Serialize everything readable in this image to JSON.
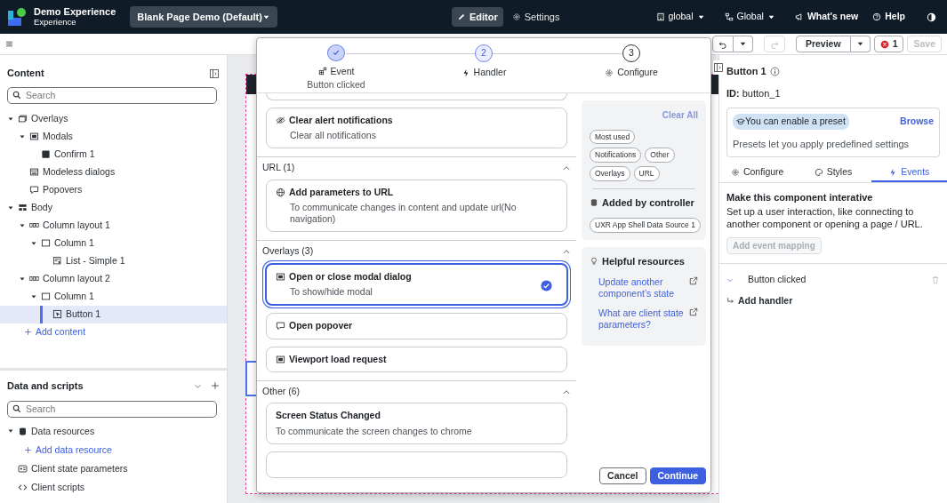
{
  "app": {
    "title": "Demo Experience",
    "subtitle": "Experience",
    "page": "Blank Page Demo (Default)"
  },
  "modes": [
    {
      "label": "Editor",
      "selected": true
    },
    {
      "label": "Settings",
      "selected": false
    }
  ],
  "header_links": [
    {
      "label": "global",
      "kind": "dropdown"
    },
    {
      "label": "Global",
      "kind": "dropdown"
    },
    {
      "label": "What's new",
      "kind": "link"
    },
    {
      "label": "Help",
      "kind": "link"
    }
  ],
  "toolbar": {
    "preview": "Preview",
    "error_count": "1",
    "save": {
      "label": "Save",
      "disabled": true
    }
  },
  "content": {
    "title": "Content",
    "search_placeholder": "Search",
    "tree": [
      {
        "label": "Overlays",
        "kind": "overlays",
        "expanded": true,
        "selected": false,
        "children": [
          {
            "label": "Modals",
            "kind": "modal",
            "expanded": true,
            "selected": false,
            "children": [
              {
                "label": "Confirm 1",
                "kind": "square",
                "selected": false
              }
            ]
          },
          {
            "label": "Modeless dialogs",
            "kind": "modeless",
            "selected": false
          },
          {
            "label": "Popovers",
            "kind": "popover",
            "selected": false
          }
        ]
      },
      {
        "label": "Body",
        "kind": "body",
        "expanded": true,
        "selected": false,
        "children": [
          {
            "label": "Column layout 1",
            "kind": "columns",
            "expanded": true,
            "selected": false,
            "children": [
              {
                "label": "Column 1",
                "kind": "column",
                "expanded": true,
                "selected": false,
                "children": [
                  {
                    "label": "List - Simple 1",
                    "kind": "list",
                    "selected": false
                  }
                ]
              }
            ]
          },
          {
            "label": "Column layout 2",
            "kind": "columns",
            "expanded": true,
            "selected": false,
            "children": [
              {
                "label": "Column 1",
                "kind": "column",
                "expanded": true,
                "selected": false,
                "children": [
                  {
                    "label": "Button 1",
                    "kind": "button",
                    "selected": true
                  }
                ]
              }
            ]
          }
        ]
      }
    ],
    "add_label": "Add content"
  },
  "data_scripts": {
    "title": "Data and scripts",
    "search_placeholder": "Search",
    "tree": [
      {
        "label": "Data resources",
        "kind": "database",
        "expanded": true,
        "selected": false,
        "add_label": "Add data resource"
      },
      {
        "label": "Client state parameters",
        "kind": "params",
        "selected": false
      },
      {
        "label": "Client scripts",
        "kind": "code",
        "selected": false
      }
    ]
  },
  "dialog": {
    "steps": [
      {
        "label": "Event",
        "sublabel": "Button clicked",
        "completed": true,
        "selected": false
      },
      {
        "number": "2",
        "label": "Handler",
        "completed": false,
        "selected": true
      },
      {
        "number": "3",
        "label": "Configure",
        "completed": false,
        "selected": false
      }
    ],
    "top_items": [
      {
        "title": "Clear alert notifications",
        "description": "Clear all notifications",
        "kind": "eye-off",
        "selected": false
      }
    ],
    "groups": [
      {
        "title": "URL (1)",
        "expanded": true,
        "items": [
          {
            "title": "Add parameters to URL",
            "description": "To communicate changes in content and update url(No navigation)",
            "kind": "globe",
            "selected": false
          }
        ]
      },
      {
        "title": "Overlays (3)",
        "expanded": true,
        "items": [
          {
            "title": "Open or close modal dialog",
            "description": "To show/hide modal",
            "kind": "modal",
            "selected": true
          },
          {
            "title": "Open popover",
            "kind": "popover",
            "selected": false
          },
          {
            "title": "Viewport load request",
            "kind": "modal",
            "selected": false
          }
        ]
      },
      {
        "title": "Other (6)",
        "expanded": true,
        "items": [
          {
            "title": "Screen Status Changed",
            "description": "To communicate the screen changes to chrome",
            "selected": false
          }
        ]
      }
    ],
    "clear_all": {
      "label": "Clear All",
      "disabled": true
    },
    "filter_rows": [
      [
        "Most used"
      ],
      [
        "Notifications",
        "Other"
      ],
      [
        "Overlays",
        "URL"
      ]
    ],
    "controller": {
      "title": "Added by controller",
      "chips": [
        "UXR App Shell Data Source 1"
      ]
    },
    "resources": {
      "title": "Helpful resources",
      "links": [
        "Update another component’s state",
        "What are client state parameters?"
      ]
    },
    "buttons": {
      "cancel": "Cancel",
      "continue": "Continue"
    }
  },
  "inspector": {
    "title": "Button 1",
    "id_label": "ID:",
    "id_value": "button_1",
    "preset": {
      "title": "You can enable a preset",
      "action": "Browse",
      "description": "Presets let you apply predefined settings"
    },
    "tabs": [
      {
        "label": "Configure",
        "selected": false
      },
      {
        "label": "Styles",
        "selected": false
      },
      {
        "label": "Events",
        "selected": true
      }
    ],
    "heading": "Make this component interative",
    "description": "Set up a user interaction, like connecting to another component or opening a page / URL.",
    "add_mapping": {
      "label": "Add event mapping",
      "disabled": true
    },
    "events": [
      {
        "label": "Button clicked",
        "expanded": true,
        "add_label": "Add handler"
      }
    ]
  }
}
